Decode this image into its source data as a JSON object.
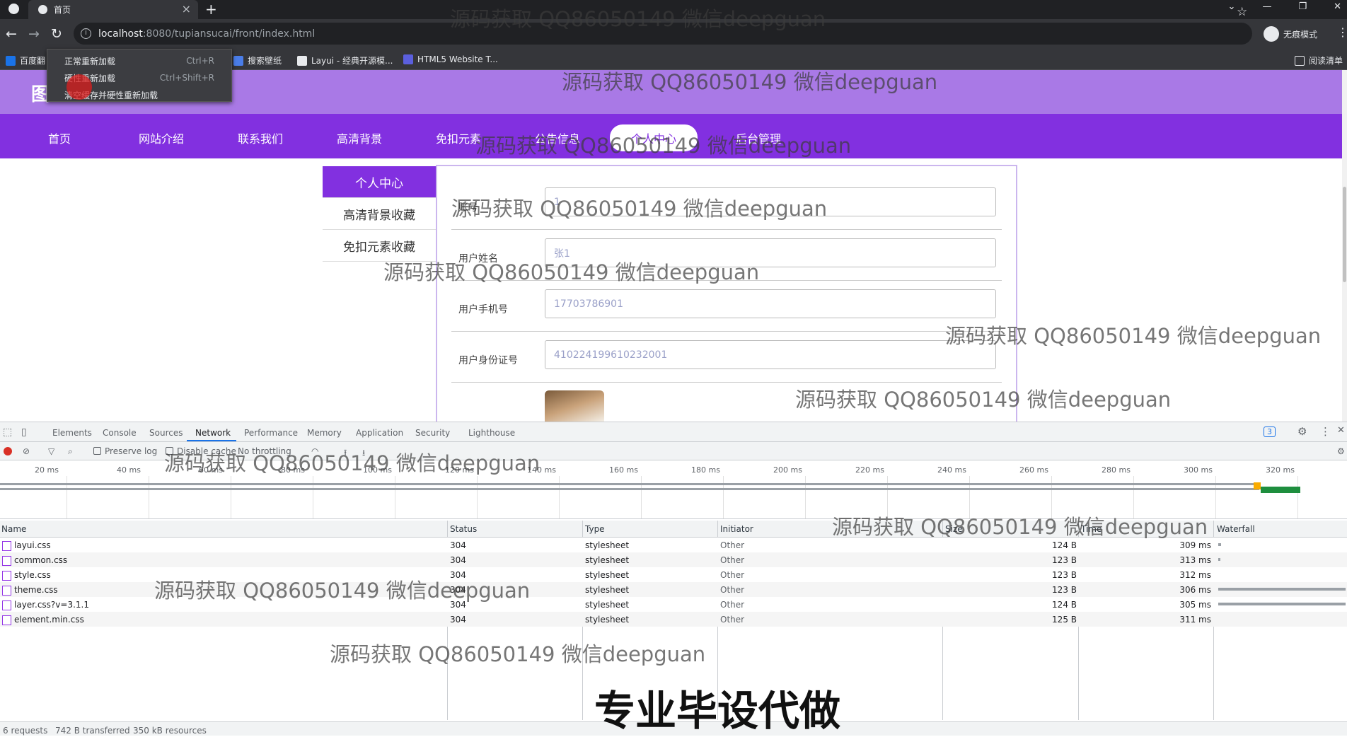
{
  "browser": {
    "tab_title": "首页",
    "url_host": "localhost",
    "url_path": ":8080/tupiansucai/front/index.html",
    "profile_label": "无痕模式",
    "bookmarks": [
      "百度翻",
      "搜索壁纸",
      "Layui - 经典开源模...",
      "HTML5 Website T..."
    ],
    "reading_list": "阅读清单"
  },
  "context_menu": {
    "items": [
      {
        "label": "正常重新加载",
        "shortcut": "Ctrl+R"
      },
      {
        "label": "硬性重新加载",
        "shortcut": "Ctrl+Shift+R"
      },
      {
        "label": "清空缓存并硬性重新加载",
        "shortcut": ""
      }
    ]
  },
  "site": {
    "logo_text": "图",
    "nav": [
      "首页",
      "网站介绍",
      "联系我们",
      "高清背景",
      "免扣元素",
      "公告信息",
      "个人中心",
      "后台管理"
    ],
    "active_nav": "个人中心",
    "side_menu": [
      "个人中心",
      "高清背景收藏",
      "免扣元素收藏"
    ],
    "form": [
      {
        "label": "账号",
        "value": "1"
      },
      {
        "label": "用户姓名",
        "value": "张1"
      },
      {
        "label": "用户手机号",
        "value": "17703786901"
      },
      {
        "label": "用户身份证号",
        "value": "410224199610232001"
      }
    ]
  },
  "devtools": {
    "tabs": [
      "Elements",
      "Console",
      "Sources",
      "Network",
      "Performance",
      "Memory",
      "Application",
      "Security",
      "Lighthouse"
    ],
    "active_tab": "Network",
    "issues_count": "3",
    "toolbar": {
      "preserve_log": "Preserve log",
      "disable_cache": "Disable cache",
      "throttling": "No throttling"
    },
    "timeline_ticks": [
      "20 ms",
      "40 ms",
      "60 ms",
      "80 ms",
      "100 ms",
      "120 ms",
      "140 ms",
      "160 ms",
      "180 ms",
      "200 ms",
      "220 ms",
      "240 ms",
      "260 ms",
      "280 ms",
      "300 ms",
      "320 ms"
    ],
    "columns": [
      "Name",
      "Status",
      "Type",
      "Initiator",
      "Size",
      "Time",
      "Waterfall"
    ],
    "rows": [
      {
        "name": "layui.css",
        "status": "304",
        "type": "stylesheet",
        "initiator": "Other",
        "size": "124 B",
        "time": "309 ms"
      },
      {
        "name": "common.css",
        "status": "304",
        "type": "stylesheet",
        "initiator": "Other",
        "size": "123 B",
        "time": "313 ms"
      },
      {
        "name": "style.css",
        "status": "304",
        "type": "stylesheet",
        "initiator": "Other",
        "size": "123 B",
        "time": "312 ms"
      },
      {
        "name": "theme.css",
        "status": "304",
        "type": "stylesheet",
        "initiator": "Other",
        "size": "123 B",
        "time": "306 ms"
      },
      {
        "name": "layer.css?v=3.1.1",
        "status": "304",
        "type": "stylesheet",
        "initiator": "Other",
        "size": "124 B",
        "time": "305 ms"
      },
      {
        "name": "element.min.css",
        "status": "304",
        "type": "stylesheet",
        "initiator": "Other",
        "size": "125 B",
        "time": "311 ms"
      }
    ],
    "status": {
      "requests": "6 requests",
      "transferred": "742 B transferred",
      "resources": "350 kB resources"
    }
  },
  "overlay": {
    "watermark": "源码获取 QQ86050149 微信deepguan",
    "caption": "专业毕设代做"
  }
}
